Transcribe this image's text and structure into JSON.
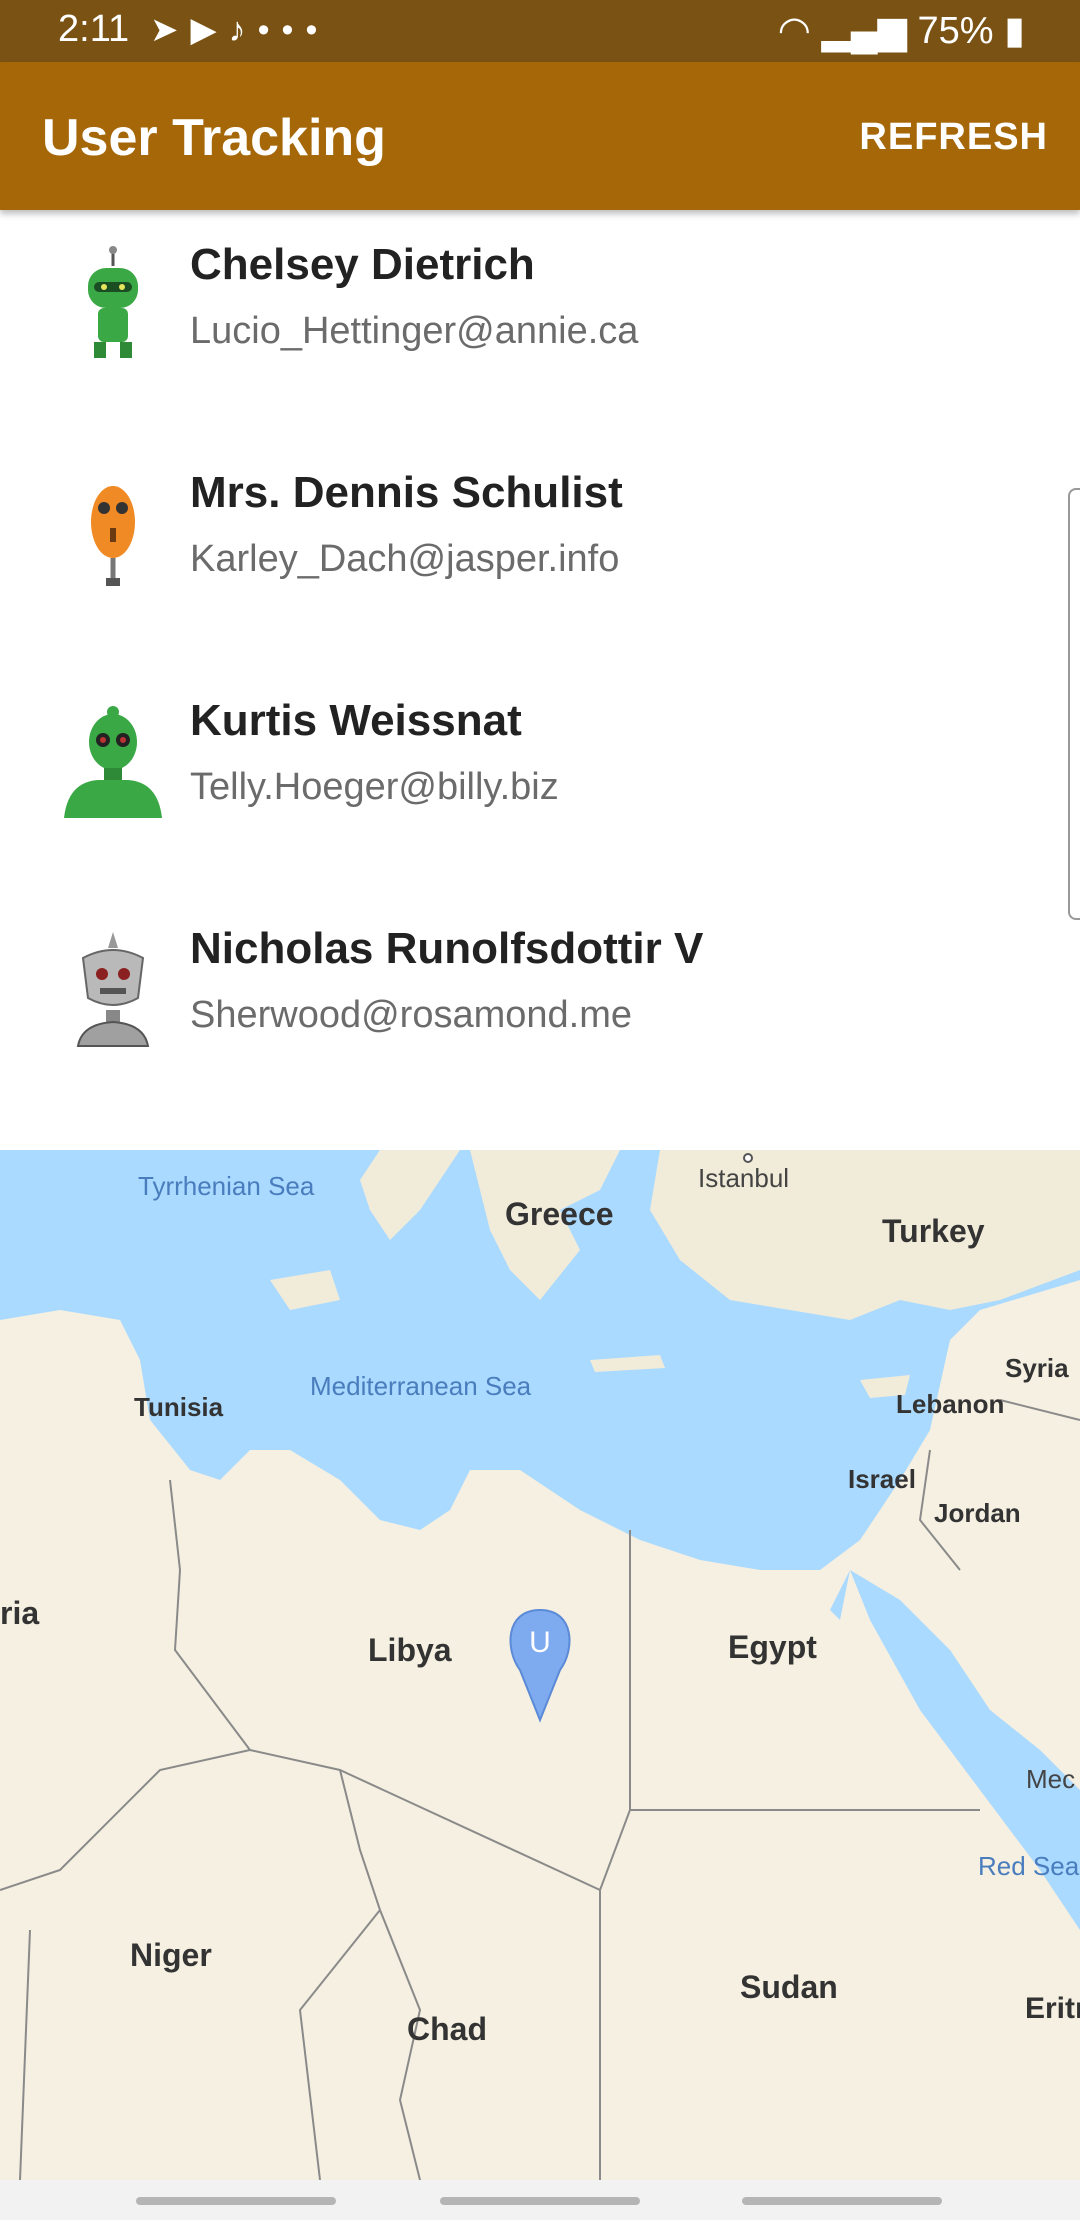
{
  "status_bar": {
    "time": "2:11",
    "notification_icons": [
      "telegram-icon",
      "feedly-icon",
      "twitter-icon",
      "more-icon"
    ],
    "more_glyph": "•••",
    "battery_percent": "75%"
  },
  "app_bar": {
    "title": "User Tracking",
    "refresh_label": "REFRESH"
  },
  "users": [
    {
      "name": "Chelsey Dietrich",
      "email": "Lucio_Hettinger@annie.ca",
      "avatar": "green-robot-antenna-icon"
    },
    {
      "name": "Mrs. Dennis Schulist",
      "email": "Karley_Dach@jasper.info",
      "avatar": "orange-robot-icon"
    },
    {
      "name": "Kurtis Weissnat",
      "email": "Telly.Hoeger@billy.biz",
      "avatar": "green-robot-bust-icon"
    },
    {
      "name": "Nicholas Runolfsdottir V",
      "email": "Sherwood@rosamond.me",
      "avatar": "grey-robot-icon"
    }
  ],
  "map": {
    "sea_labels": [
      "Tyrrhenian Sea",
      "Mediterranean Sea",
      "Red Sea"
    ],
    "country_labels": [
      "Greece",
      "Turkey",
      "Syria",
      "Lebanon",
      "Israel",
      "Jordan",
      "Tunisia",
      "Libya",
      "Egypt",
      "Niger",
      "Chad",
      "Sudan",
      "Eritrea"
    ],
    "city_labels": [
      "Istanbul"
    ],
    "partial_labels": [
      "ria",
      "Mec"
    ],
    "marker_letter": "U",
    "colors": {
      "water": "#aadaff",
      "land": "#f5f0e1",
      "marker": "#7eaaf0",
      "border": "#8a8a8a"
    }
  },
  "colors": {
    "app_bar": "#a66708",
    "status_bar": "#7a5314"
  }
}
